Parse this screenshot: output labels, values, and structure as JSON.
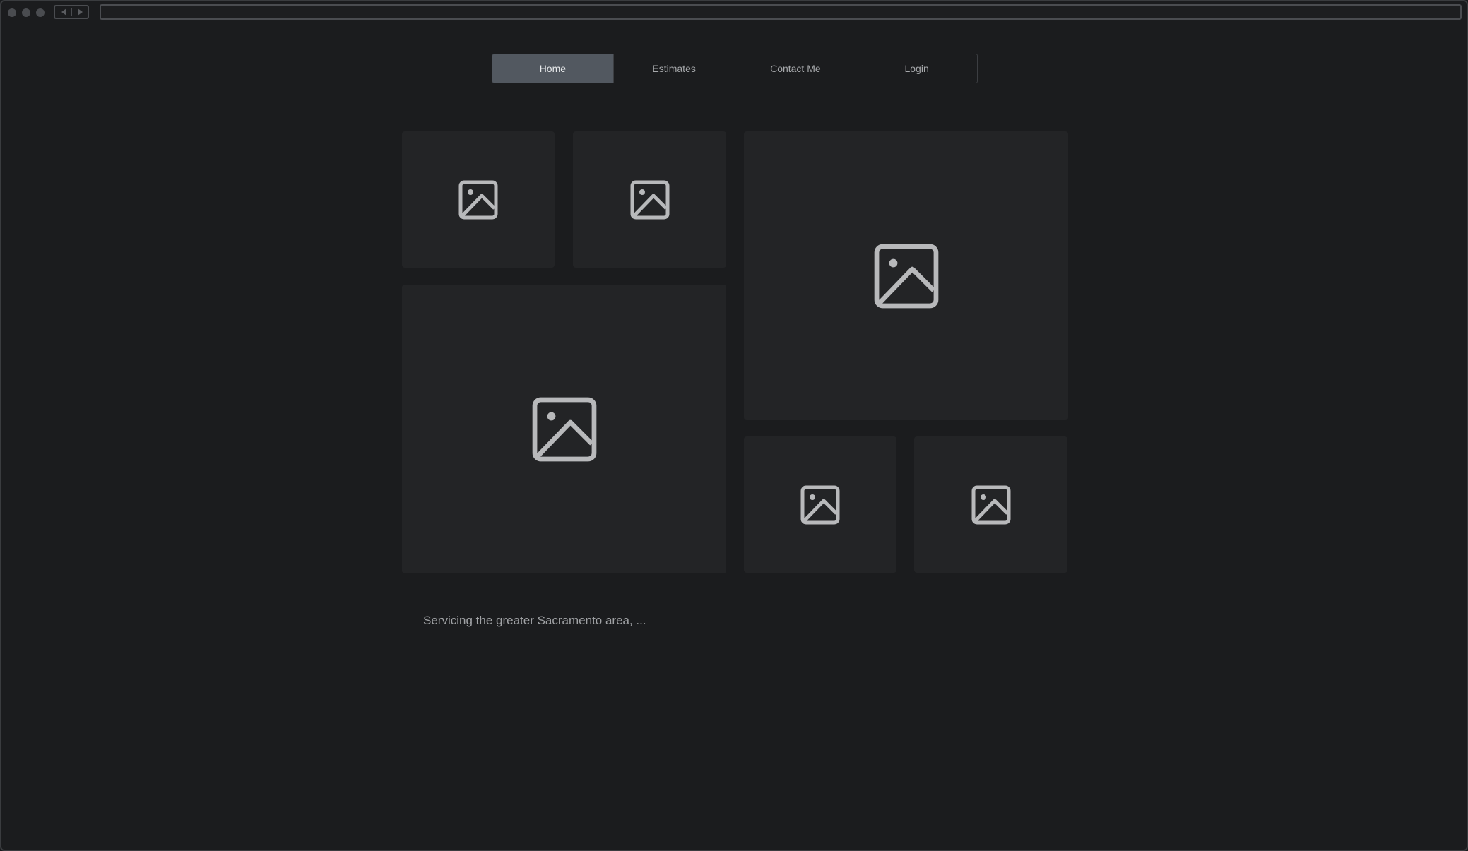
{
  "nav": {
    "tabs": [
      {
        "label": "Home",
        "active": true
      },
      {
        "label": "Estimates",
        "active": false
      },
      {
        "label": "Contact Me",
        "active": false
      },
      {
        "label": "Login",
        "active": false
      }
    ]
  },
  "gallery": {
    "icon": "image-placeholder-icon",
    "tile_count": 6
  },
  "caption": "Servicing the greater Sacramento area, ...",
  "colors": {
    "background": "#1b1c1e",
    "tile": "#232426",
    "active_tab": "#525860",
    "icon": "#b8b9bb"
  }
}
